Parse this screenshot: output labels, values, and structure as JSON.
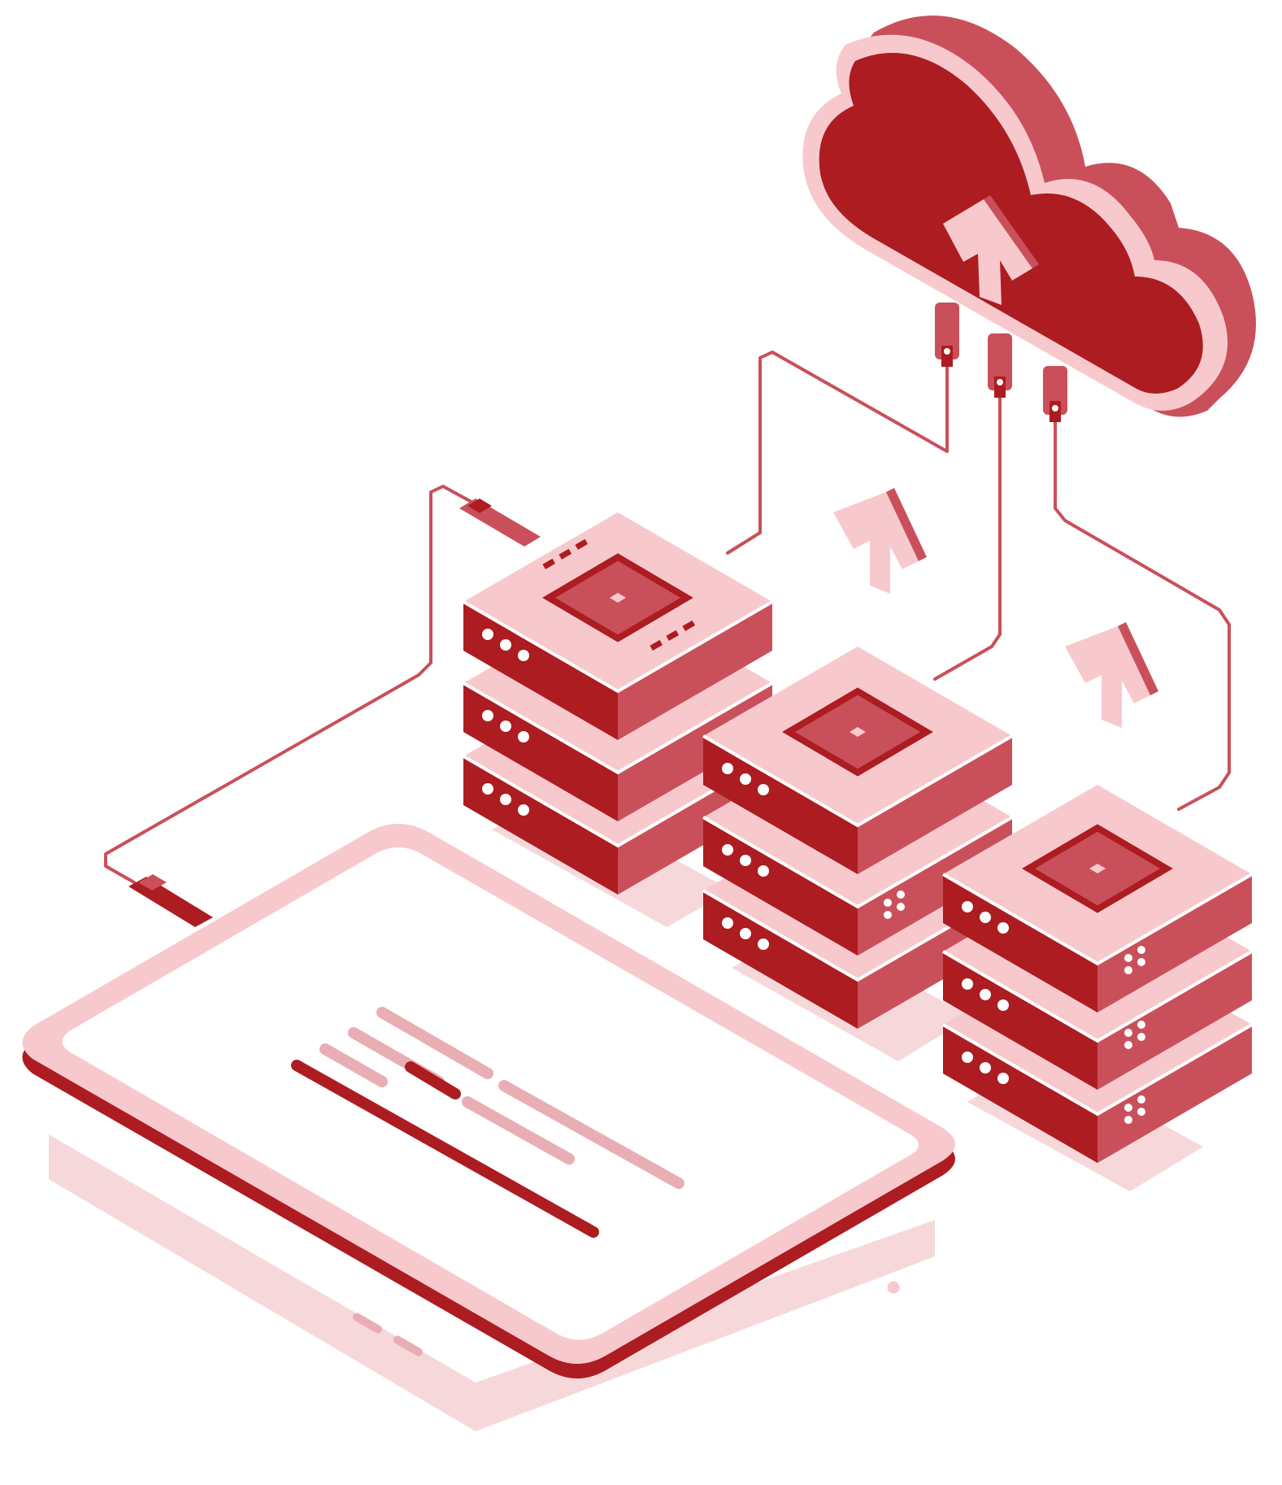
{
  "illustration": {
    "subject": "cloud-upload-servers-tablet",
    "icons": [
      "cloud-icon",
      "upload-arrow-icon",
      "server-stack-icon",
      "tablet-icon",
      "cable-icon",
      "connector-plug-icon"
    ],
    "colors": {
      "dark_red": "#ac1c20",
      "mid_red": "#c9505a",
      "light_pink": "#f7c9cd",
      "pale_pink": "#fbe4e6",
      "blush": "#e8aeb4",
      "shadow": "#f3d2d6",
      "background": "#ffffff"
    },
    "server_stacks": [
      {
        "id": "left",
        "units": 3
      },
      {
        "id": "middle",
        "units": 3
      },
      {
        "id": "right",
        "units": 3
      }
    ],
    "cloud_connectors": 3,
    "floating_upload_arrows": 2
  }
}
